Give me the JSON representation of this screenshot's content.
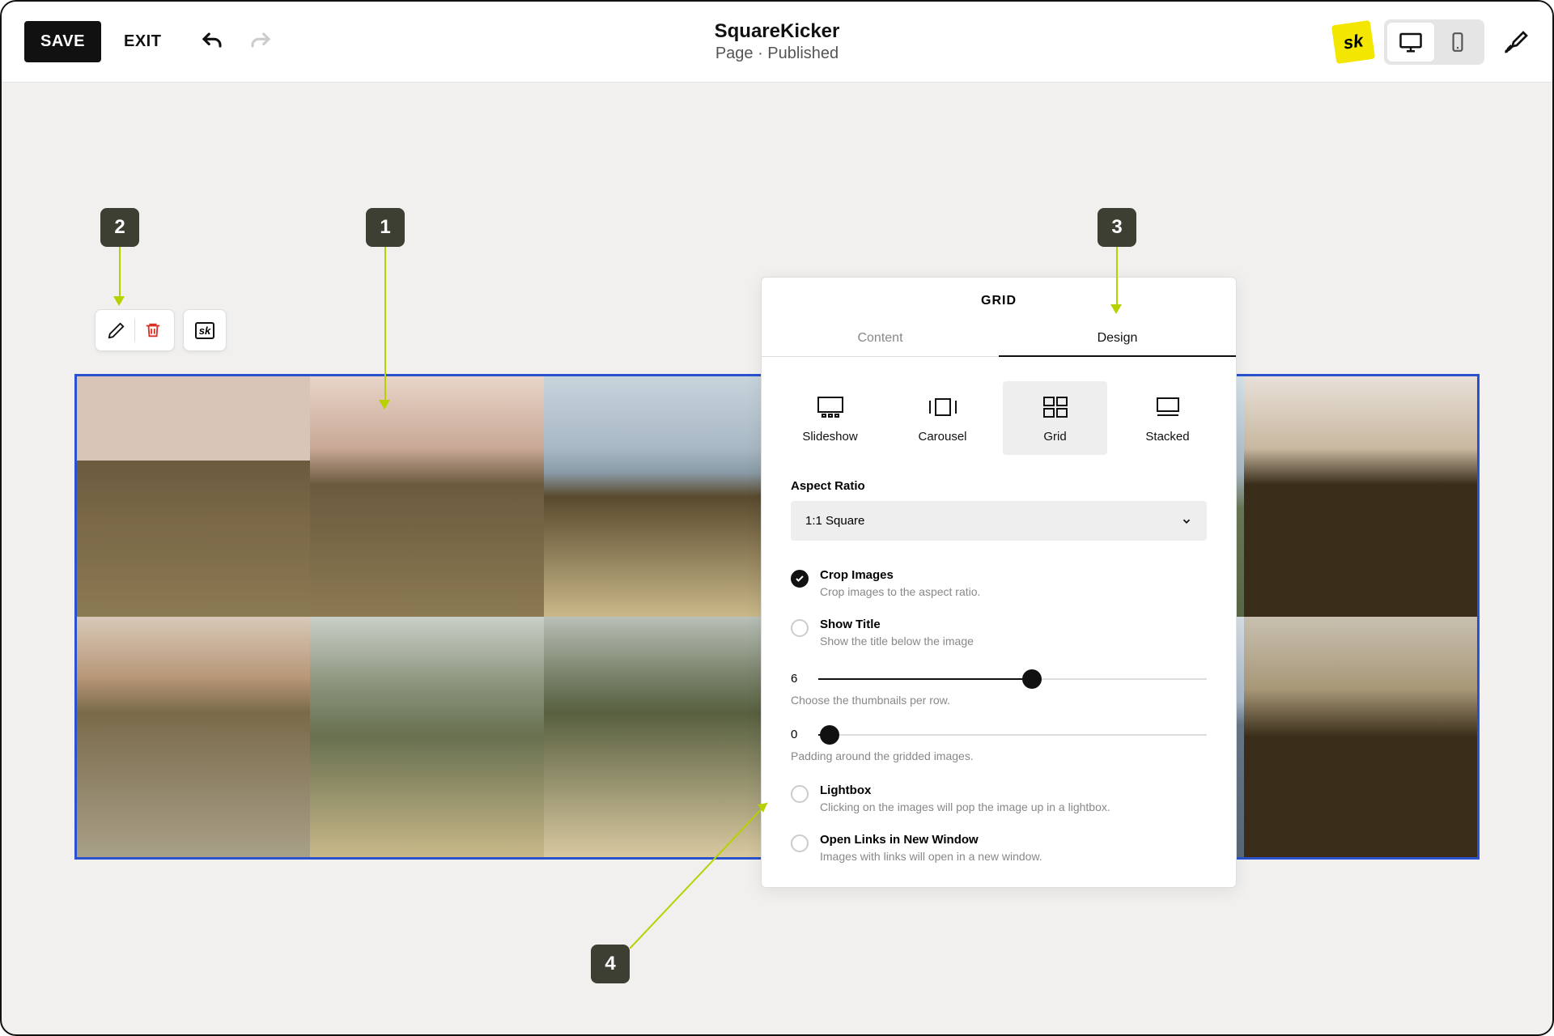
{
  "topbar": {
    "save": "SAVE",
    "exit": "EXIT",
    "title": "SquareKicker",
    "subtitle": "Page · Published",
    "sk_badge": "sk"
  },
  "annotations": {
    "a1": "1",
    "a2": "2",
    "a3": "3",
    "a4": "4"
  },
  "panel": {
    "title": "GRID",
    "tabs": {
      "content": "Content",
      "design": "Design"
    },
    "layouts": {
      "slideshow": "Slideshow",
      "carousel": "Carousel",
      "grid": "Grid",
      "stacked": "Stacked"
    },
    "aspect": {
      "label": "Aspect Ratio",
      "value": "1:1 Square"
    },
    "crop": {
      "title": "Crop Images",
      "desc": "Crop images to the aspect ratio."
    },
    "showtitle": {
      "title": "Show Title",
      "desc": "Show the title below the image"
    },
    "thumbs": {
      "value": "6",
      "desc": "Choose the thumbnails per row."
    },
    "padding": {
      "value": "0",
      "desc": "Padding around the gridded images."
    },
    "lightbox": {
      "title": "Lightbox",
      "desc": "Clicking on the images will pop the image up in a lightbox."
    },
    "newwin": {
      "title": "Open Links in New Window",
      "desc": "Images with links will open in a new window."
    }
  }
}
